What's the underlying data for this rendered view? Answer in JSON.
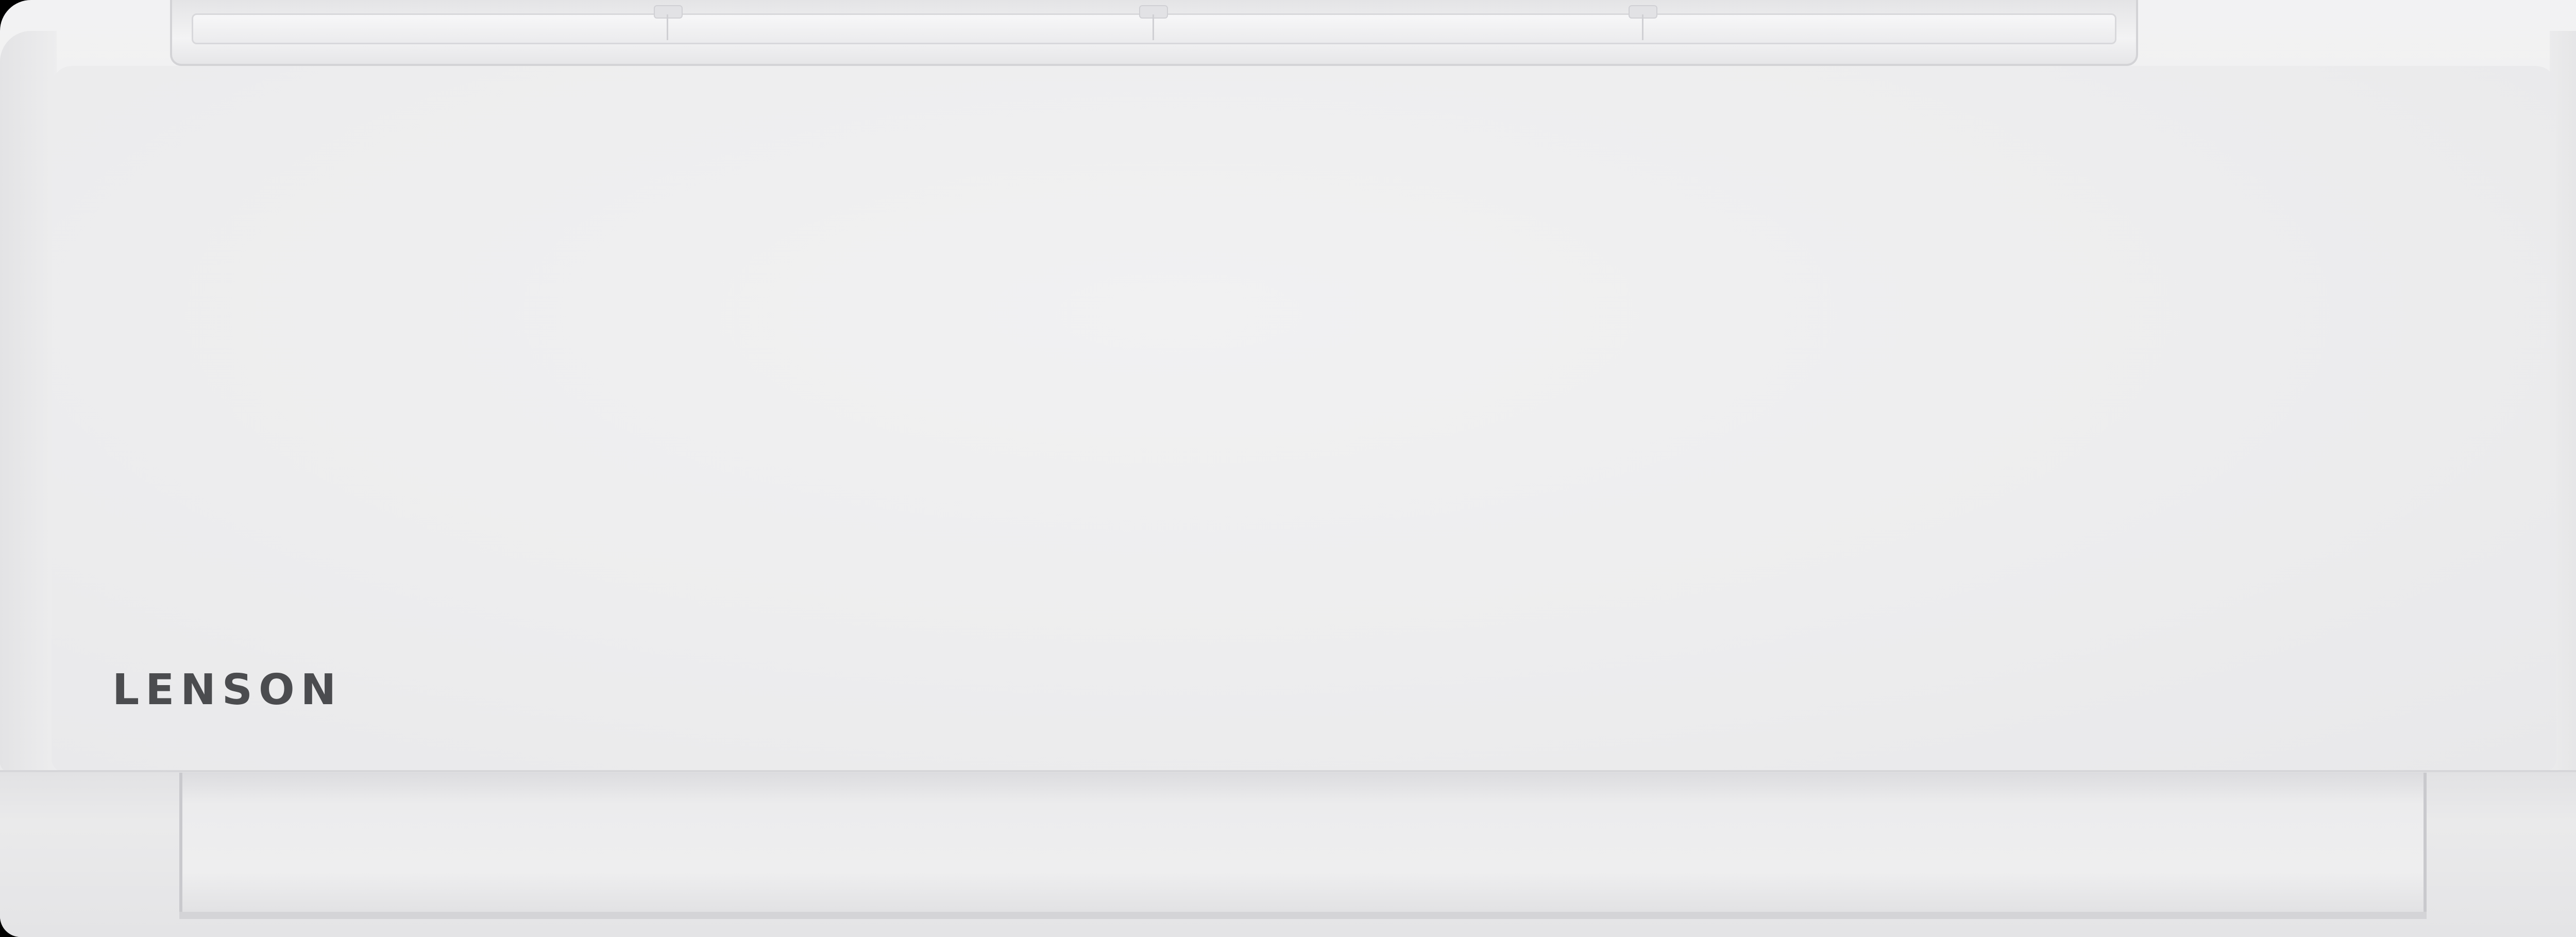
{
  "product": {
    "brand_logo_text": "LENSON",
    "logo_color": "#4b4c4f",
    "body_color": "#ededee",
    "background_color": "#000000"
  },
  "icons": {
    "logo": "lenson-logo-icon"
  }
}
